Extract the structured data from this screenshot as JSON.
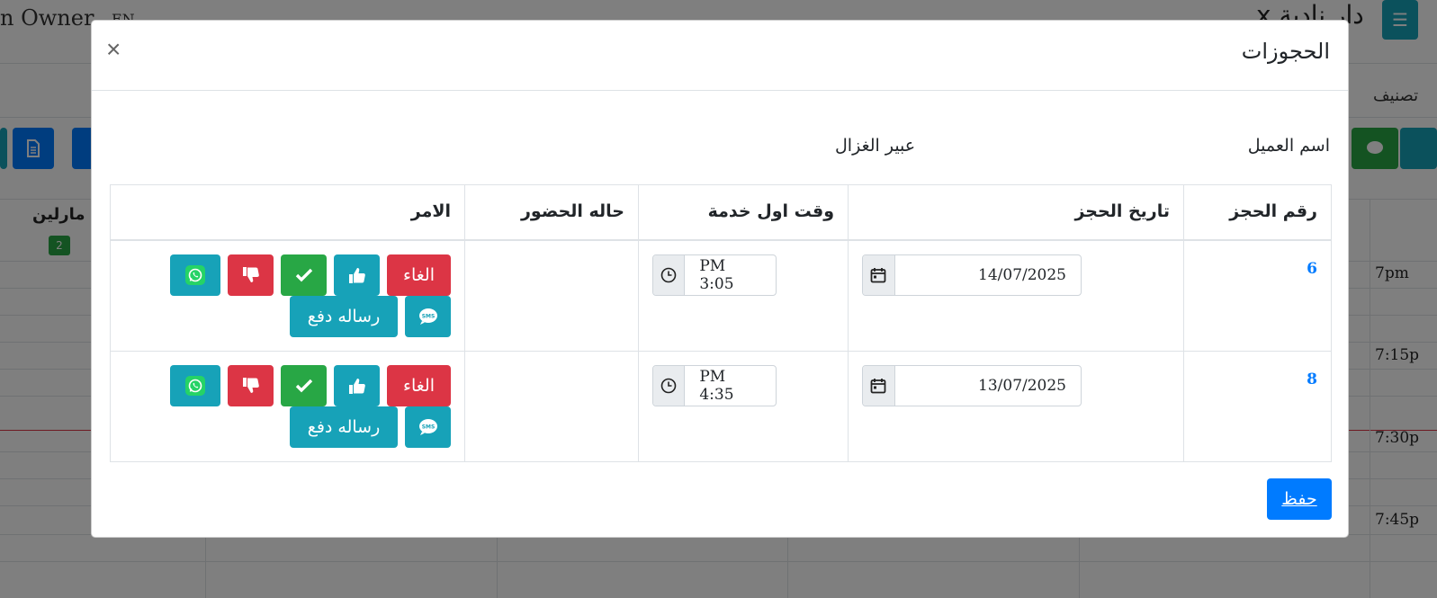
{
  "background": {
    "owner_label": "n Owner",
    "lang_label": "EN",
    "app_title": "دار نادية x",
    "classify_label": "تصنيف",
    "staff_name": "مارلين",
    "staff_count": "2",
    "times": [
      "7pm",
      "7:15p",
      "7:30p",
      "7:45p"
    ]
  },
  "modal": {
    "title": "الحجوزات",
    "close_glyph": "×",
    "customer_label": "اسم العميل",
    "customer_name": "عبير الغزال",
    "columns": {
      "booking_number": "رقم الحجز",
      "booking_date": "تاريخ الحجز",
      "first_service_time": "وقت اول خدمة",
      "attendance": "حاله الحضور",
      "action": "الامر"
    },
    "rows": [
      {
        "number": "6",
        "date": "14/07/2025",
        "time": "PM 3:05",
        "attendance": ""
      },
      {
        "number": "8",
        "date": "13/07/2025",
        "time": "PM 4:35",
        "attendance": ""
      }
    ],
    "buttons": {
      "cancel": "الغاء",
      "payment_message": "رساله دفع"
    },
    "save_label": "حفظ"
  },
  "colors": {
    "primary": "#007bff",
    "danger": "#dc3545",
    "info": "#17a2b8",
    "success": "#28a745"
  }
}
